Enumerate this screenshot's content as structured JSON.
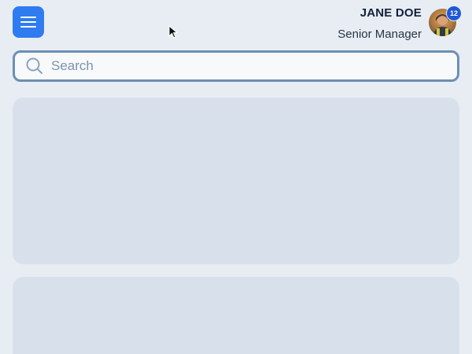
{
  "header": {
    "menu_icon": "hamburger-menu-icon",
    "user": {
      "name": "JANE DOE",
      "role": "Senior Manager",
      "notification_count": "12"
    }
  },
  "search": {
    "placeholder": "Search",
    "value": "",
    "icon": "search-icon"
  },
  "colors": {
    "background": "#e8edf3",
    "accent": "#2e7cf0",
    "badge": "#1f58d6",
    "search_border": "#6d8fb3",
    "skeleton": "#d8e1eb"
  }
}
